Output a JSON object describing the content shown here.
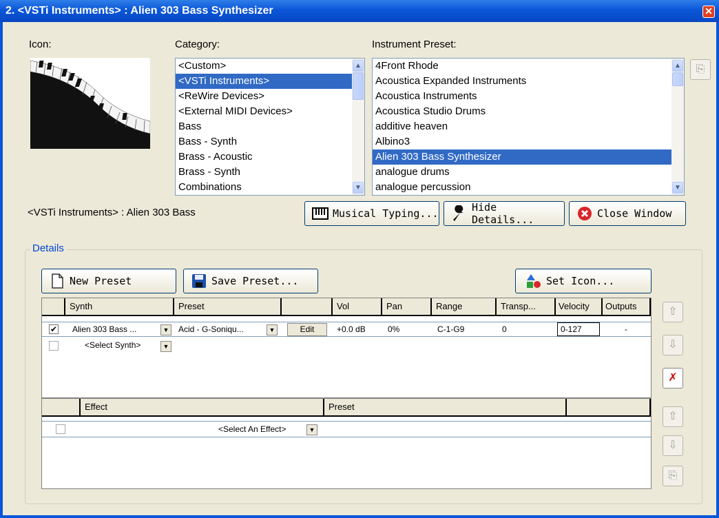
{
  "window": {
    "title": "2. <VSTi Instruments> : Alien 303 Bass Synthesizer",
    "close_glyph": "✕"
  },
  "labels": {
    "icon": "Icon:",
    "category": "Category:",
    "instrument_preset": "Instrument Preset:",
    "summary": "<VSTi Instruments> : Alien 303 Bass",
    "details": "Details"
  },
  "category_list": {
    "items": [
      "<Custom>",
      "<VSTi Instruments>",
      "<ReWire Devices>",
      "<External MIDI Devices>",
      "Bass",
      "Bass - Synth",
      "Brass - Acoustic",
      "Brass - Synth",
      "Combinations"
    ],
    "selected": "<VSTi Instruments>"
  },
  "preset_list": {
    "items": [
      "4Front Rhode",
      "Acoustica Expanded Instruments",
      "Acoustica Instruments",
      "Acoustica Studio Drums",
      "additive heaven",
      "Albino3",
      "Alien 303 Bass Synthesizer",
      "analogue drums",
      "analogue percussion"
    ],
    "selected": "Alien 303 Bass Synthesizer"
  },
  "buttons": {
    "musical_typing": "Musical Typing...",
    "hide_details": "Hide Details...",
    "close_window": "Close Window",
    "new_preset": "New Preset",
    "save_preset": "Save Preset...",
    "set_icon": "Set Icon..."
  },
  "synth_table": {
    "headers": [
      "Synth",
      "Preset",
      "",
      "Vol",
      "Pan",
      "Range",
      "Transp...",
      "Velocity",
      "Outputs"
    ],
    "row": {
      "checked": "✔",
      "synth": "Alien 303 Bass ...",
      "preset": "Acid - G-Soniqu...",
      "edit": "Edit",
      "vol": "+0.0 dB",
      "pan": "0%",
      "range": "C-1-G9",
      "transp": "0",
      "velocity": "0-127",
      "outputs": "-"
    },
    "empty_row": {
      "synth": "<Select Synth>"
    }
  },
  "effect_table": {
    "headers": [
      "Effect",
      "Preset"
    ],
    "row": {
      "effect": "<Select An Effect>"
    }
  },
  "icons": {
    "dropdown": "▼",
    "up": "⇧",
    "down": "⇩",
    "scroll_up": "▲",
    "scroll_down": "▼"
  },
  "colors": {
    "titlebar": "#0a56d8",
    "selection": "#316ac5",
    "group_title": "#0046d5",
    "close_red": "#d9262b"
  }
}
